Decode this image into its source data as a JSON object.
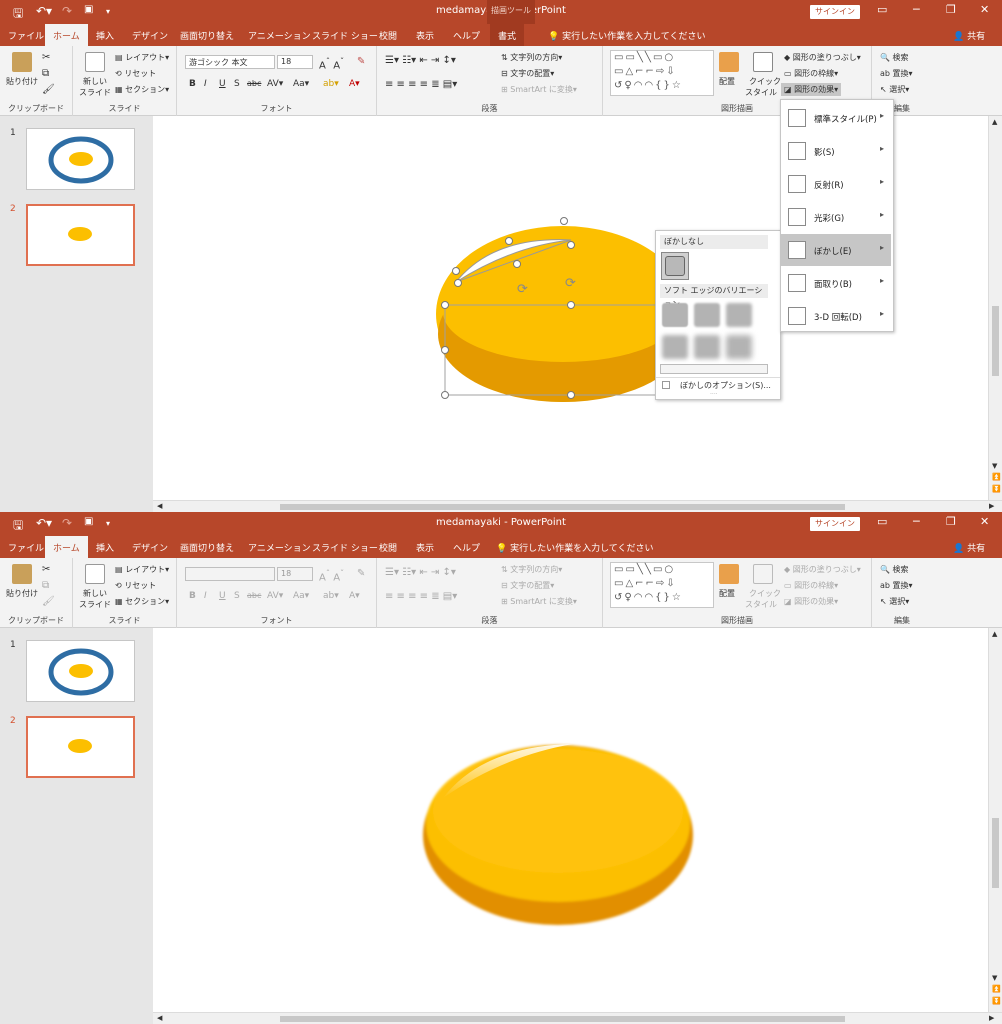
{
  "top": {
    "title": "medamayaki  -  PowerPoint",
    "drawing_tools": "描画ツール",
    "signin": "サインイン",
    "tabs": {
      "file": "ファイル",
      "home": "ホーム",
      "insert": "挿入",
      "design": "デザイン",
      "transitions": "画面切り替え",
      "animations": "アニメーション",
      "slideshow": "スライド ショー",
      "review": "校閲",
      "view": "表示",
      "help": "ヘルプ",
      "format": "書式"
    },
    "tellme": "実行したい作業を入力してください",
    "share": "共有",
    "ribbon": {
      "paste": "貼り付け",
      "clipboard": "クリップボード",
      "new_slide_1": "新しい",
      "new_slide_2": "スライド",
      "layout": "レイアウト",
      "reset": "リセット",
      "section": "セクション",
      "slides": "スライド",
      "font_name": "游ゴシック 本文",
      "font_size": "18",
      "font": "フォント",
      "text_direction": "文字列の方向",
      "align_text": "文字の配置",
      "smartart": "SmartArt に変換",
      "paragraph": "段落",
      "arrange": "配置",
      "quick_style_1": "クイック",
      "quick_style_2": "スタイル",
      "shape_fill": "図形の塗りつぶし",
      "shape_outline": "図形の枠線",
      "shape_effects": "図形の効果",
      "drawing": "図形描画",
      "find": "検索",
      "replace": "置換",
      "select": "選択",
      "editing": "編集"
    },
    "effects_menu": [
      {
        "label": "標準スタイル(P)"
      },
      {
        "label": "影(S)"
      },
      {
        "label": "反射(R)"
      },
      {
        "label": "光彩(G)"
      },
      {
        "label": "ぼかし(E)"
      },
      {
        "label": "面取り(B)"
      },
      {
        "label": "3-D 回転(D)"
      }
    ],
    "soft_edges": {
      "no_soft": "ぼかしなし",
      "variations": "ソフト エッジのバリエーション",
      "options": "ぼかしのオプション(S)...",
      "dots": "····"
    }
  },
  "bottom": {
    "title": "medamayaki  -  PowerPoint",
    "signin": "サインイン",
    "tabs": {
      "file": "ファイル",
      "home": "ホーム",
      "insert": "挿入",
      "design": "デザイン",
      "transitions": "画面切り替え",
      "animations": "アニメーション",
      "slideshow": "スライド ショー",
      "review": "校閲",
      "view": "表示",
      "help": "ヘルプ"
    },
    "tellme": "実行したい作業を入力してください",
    "share": "共有",
    "ribbon": {
      "paste": "貼り付け",
      "clipboard": "クリップボード",
      "new_slide_1": "新しい",
      "new_slide_2": "スライド",
      "layout": "レイアウト",
      "reset": "リセット",
      "section": "セクション",
      "slides": "スライド",
      "font_size": "18",
      "font": "フォント",
      "text_direction": "文字列の方向",
      "align_text": "文字の配置",
      "smartart": "SmartArt に変換",
      "paragraph": "段落",
      "arrange": "配置",
      "quick_style_1": "クイック",
      "quick_style_2": "スタイル",
      "shape_fill": "図形の塗りつぶし",
      "shape_outline": "図形の枠線",
      "shape_effects": "図形の効果",
      "drawing": "図形描画",
      "find": "検索",
      "replace": "置換",
      "select": "選択",
      "editing": "編集"
    }
  },
  "slides": [
    {
      "number": "1"
    },
    {
      "number": "2"
    }
  ],
  "colors": {
    "accent": "#b7472a",
    "yolk": "#fcbf00",
    "yolk_dark": "#e49a00",
    "egg_ring": "#2e6da4"
  }
}
